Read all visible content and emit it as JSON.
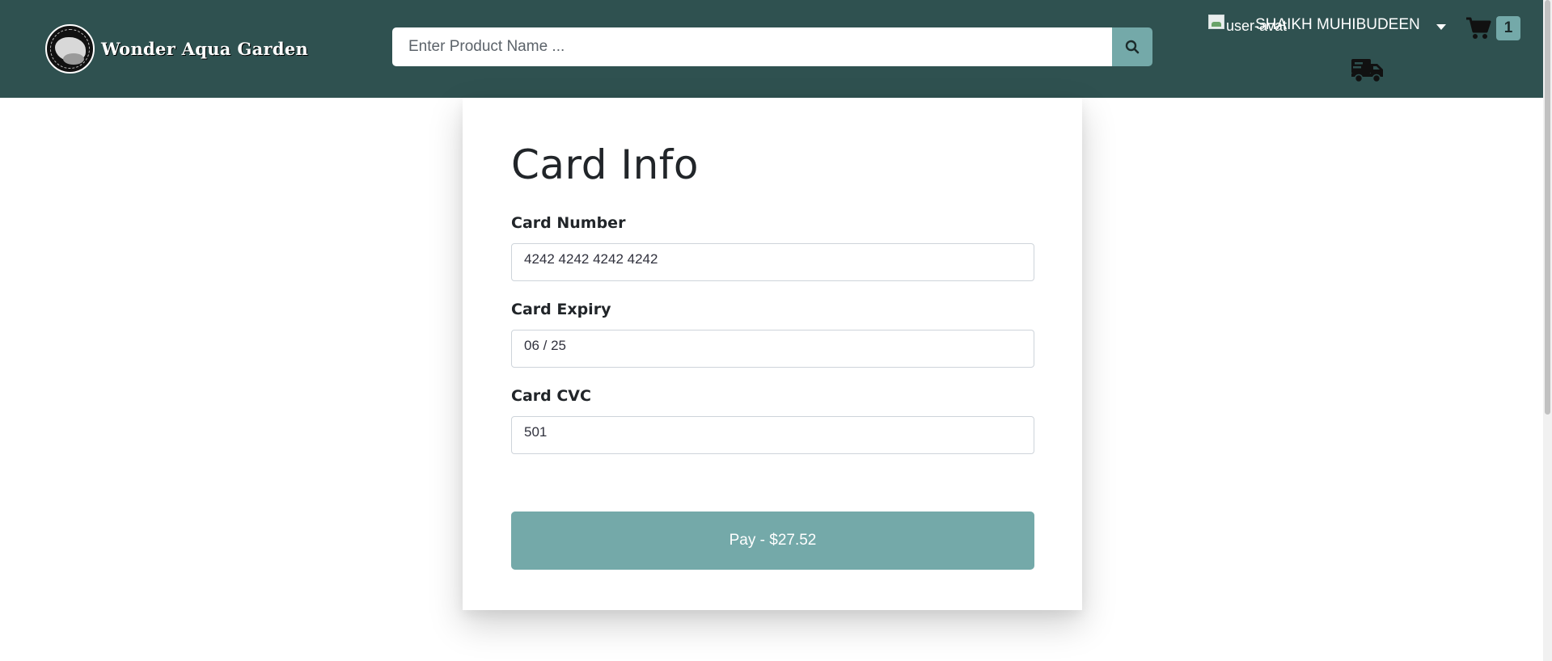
{
  "header": {
    "brand": "Wonder Aqua Garden",
    "search": {
      "placeholder": "Enter Product Name ...",
      "value": ""
    },
    "user": {
      "avatar_alt": "user-avat",
      "name": "SHAIKH MUHIBUDEEN"
    },
    "cart": {
      "count": "1"
    }
  },
  "icons": {
    "logo": "logo-icon",
    "search": "search-icon",
    "dropdown": "caret-down-icon",
    "cart": "cart-icon",
    "orders": "truck-icon"
  },
  "card_form": {
    "title": "Card Info",
    "fields": [
      {
        "label": "Card Number",
        "value": "4242 4242 4242 4242"
      },
      {
        "label": "Card Expiry",
        "value": "06 / 25"
      },
      {
        "label": "Card CVC",
        "value": "501"
      }
    ],
    "pay_label": "Pay - $27.52"
  },
  "colors": {
    "header_bg": "#2f5150",
    "accent": "#74a9a9"
  }
}
